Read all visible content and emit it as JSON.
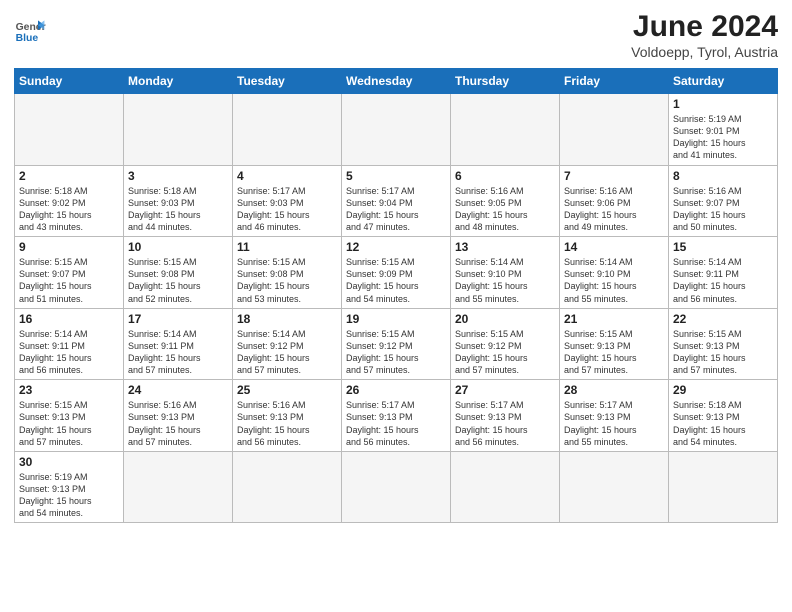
{
  "header": {
    "logo_general": "General",
    "logo_blue": "Blue",
    "title": "June 2024",
    "subtitle": "Voldoepp, Tyrol, Austria"
  },
  "weekdays": [
    "Sunday",
    "Monday",
    "Tuesday",
    "Wednesday",
    "Thursday",
    "Friday",
    "Saturday"
  ],
  "weeks": [
    [
      {
        "day": "",
        "info": ""
      },
      {
        "day": "",
        "info": ""
      },
      {
        "day": "",
        "info": ""
      },
      {
        "day": "",
        "info": ""
      },
      {
        "day": "",
        "info": ""
      },
      {
        "day": "",
        "info": ""
      },
      {
        "day": "1",
        "info": "Sunrise: 5:19 AM\nSunset: 9:01 PM\nDaylight: 15 hours\nand 41 minutes."
      }
    ],
    [
      {
        "day": "2",
        "info": "Sunrise: 5:18 AM\nSunset: 9:02 PM\nDaylight: 15 hours\nand 43 minutes."
      },
      {
        "day": "3",
        "info": "Sunrise: 5:18 AM\nSunset: 9:03 PM\nDaylight: 15 hours\nand 44 minutes."
      },
      {
        "day": "4",
        "info": "Sunrise: 5:17 AM\nSunset: 9:03 PM\nDaylight: 15 hours\nand 46 minutes."
      },
      {
        "day": "5",
        "info": "Sunrise: 5:17 AM\nSunset: 9:04 PM\nDaylight: 15 hours\nand 47 minutes."
      },
      {
        "day": "6",
        "info": "Sunrise: 5:16 AM\nSunset: 9:05 PM\nDaylight: 15 hours\nand 48 minutes."
      },
      {
        "day": "7",
        "info": "Sunrise: 5:16 AM\nSunset: 9:06 PM\nDaylight: 15 hours\nand 49 minutes."
      },
      {
        "day": "8",
        "info": "Sunrise: 5:16 AM\nSunset: 9:07 PM\nDaylight: 15 hours\nand 50 minutes."
      }
    ],
    [
      {
        "day": "9",
        "info": "Sunrise: 5:15 AM\nSunset: 9:07 PM\nDaylight: 15 hours\nand 51 minutes."
      },
      {
        "day": "10",
        "info": "Sunrise: 5:15 AM\nSunset: 9:08 PM\nDaylight: 15 hours\nand 52 minutes."
      },
      {
        "day": "11",
        "info": "Sunrise: 5:15 AM\nSunset: 9:08 PM\nDaylight: 15 hours\nand 53 minutes."
      },
      {
        "day": "12",
        "info": "Sunrise: 5:15 AM\nSunset: 9:09 PM\nDaylight: 15 hours\nand 54 minutes."
      },
      {
        "day": "13",
        "info": "Sunrise: 5:14 AM\nSunset: 9:10 PM\nDaylight: 15 hours\nand 55 minutes."
      },
      {
        "day": "14",
        "info": "Sunrise: 5:14 AM\nSunset: 9:10 PM\nDaylight: 15 hours\nand 55 minutes."
      },
      {
        "day": "15",
        "info": "Sunrise: 5:14 AM\nSunset: 9:11 PM\nDaylight: 15 hours\nand 56 minutes."
      }
    ],
    [
      {
        "day": "16",
        "info": "Sunrise: 5:14 AM\nSunset: 9:11 PM\nDaylight: 15 hours\nand 56 minutes."
      },
      {
        "day": "17",
        "info": "Sunrise: 5:14 AM\nSunset: 9:11 PM\nDaylight: 15 hours\nand 57 minutes."
      },
      {
        "day": "18",
        "info": "Sunrise: 5:14 AM\nSunset: 9:12 PM\nDaylight: 15 hours\nand 57 minutes."
      },
      {
        "day": "19",
        "info": "Sunrise: 5:15 AM\nSunset: 9:12 PM\nDaylight: 15 hours\nand 57 minutes."
      },
      {
        "day": "20",
        "info": "Sunrise: 5:15 AM\nSunset: 9:12 PM\nDaylight: 15 hours\nand 57 minutes."
      },
      {
        "day": "21",
        "info": "Sunrise: 5:15 AM\nSunset: 9:13 PM\nDaylight: 15 hours\nand 57 minutes."
      },
      {
        "day": "22",
        "info": "Sunrise: 5:15 AM\nSunset: 9:13 PM\nDaylight: 15 hours\nand 57 minutes."
      }
    ],
    [
      {
        "day": "23",
        "info": "Sunrise: 5:15 AM\nSunset: 9:13 PM\nDaylight: 15 hours\nand 57 minutes."
      },
      {
        "day": "24",
        "info": "Sunrise: 5:16 AM\nSunset: 9:13 PM\nDaylight: 15 hours\nand 57 minutes."
      },
      {
        "day": "25",
        "info": "Sunrise: 5:16 AM\nSunset: 9:13 PM\nDaylight: 15 hours\nand 56 minutes."
      },
      {
        "day": "26",
        "info": "Sunrise: 5:17 AM\nSunset: 9:13 PM\nDaylight: 15 hours\nand 56 minutes."
      },
      {
        "day": "27",
        "info": "Sunrise: 5:17 AM\nSunset: 9:13 PM\nDaylight: 15 hours\nand 56 minutes."
      },
      {
        "day": "28",
        "info": "Sunrise: 5:17 AM\nSunset: 9:13 PM\nDaylight: 15 hours\nand 55 minutes."
      },
      {
        "day": "29",
        "info": "Sunrise: 5:18 AM\nSunset: 9:13 PM\nDaylight: 15 hours\nand 54 minutes."
      }
    ],
    [
      {
        "day": "30",
        "info": "Sunrise: 5:19 AM\nSunset: 9:13 PM\nDaylight: 15 hours\nand 54 minutes."
      },
      {
        "day": "",
        "info": ""
      },
      {
        "day": "",
        "info": ""
      },
      {
        "day": "",
        "info": ""
      },
      {
        "day": "",
        "info": ""
      },
      {
        "day": "",
        "info": ""
      },
      {
        "day": "",
        "info": ""
      }
    ]
  ]
}
